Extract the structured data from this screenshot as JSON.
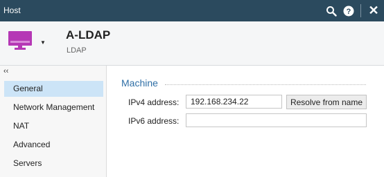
{
  "window": {
    "title": "Host",
    "icons": [
      "search-icon",
      "help-icon",
      "close-icon"
    ],
    "bar_color": "#2b4a5e"
  },
  "header": {
    "icon": "monitor-icon",
    "icon_color": "#b538b5",
    "name": "A-LDAP",
    "subtitle": "LDAP"
  },
  "sidebar": {
    "collapse_glyph": "‹‹",
    "items": [
      {
        "label": "General",
        "active": true
      },
      {
        "label": "Network Management",
        "active": false
      },
      {
        "label": "NAT",
        "active": false
      },
      {
        "label": "Advanced",
        "active": false
      },
      {
        "label": "Servers",
        "active": false
      }
    ]
  },
  "main": {
    "section_title": "Machine",
    "ipv4": {
      "label": "IPv4 address:",
      "value": "192.168.234.22"
    },
    "ipv6": {
      "label": "IPv6 address:",
      "value": ""
    },
    "resolve_button": "Resolve from name"
  }
}
